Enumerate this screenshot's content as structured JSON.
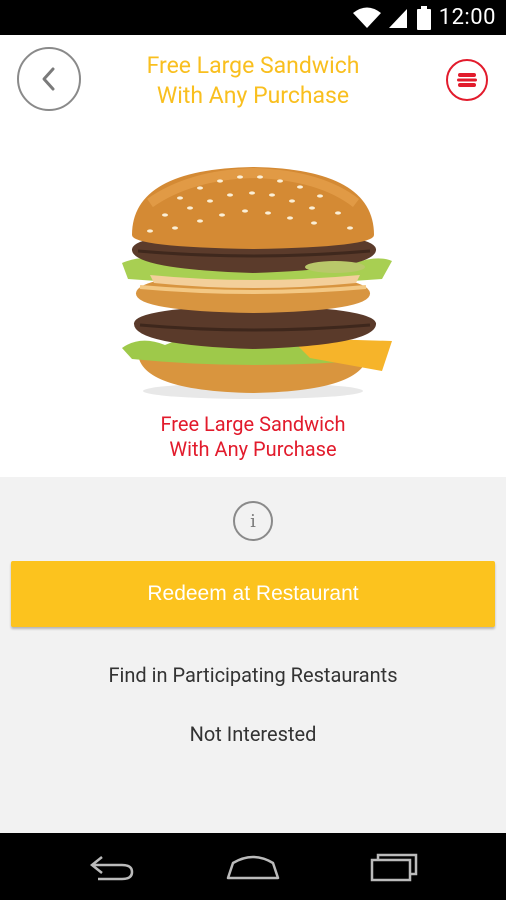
{
  "status_bar": {
    "time": "12:00",
    "icons": [
      "wifi-icon",
      "cell-signal-icon",
      "battery-icon"
    ]
  },
  "header": {
    "title_line1": "Free Large Sandwich",
    "title_line2": "With Any Purchase",
    "back_icon": "chevron-left-icon",
    "menu_icon": "menu-lines-icon"
  },
  "hero": {
    "image": "big-mac-burger",
    "caption_line1": "Free Large Sandwich",
    "caption_line2": "With Any Purchase"
  },
  "actions": {
    "info_label": "i",
    "redeem_label": "Redeem at Restaurant",
    "find_label": "Find in Participating Restaurants",
    "not_interested_label": "Not Interested"
  },
  "nav_bar": {
    "buttons": [
      "back-nav-icon",
      "home-nav-icon",
      "recents-nav-icon"
    ]
  },
  "colors": {
    "accent_yellow": "#fcc31e",
    "title_yellow": "#f9bf1f",
    "brand_red": "#e21b2c",
    "background": "#f2f2f2"
  }
}
